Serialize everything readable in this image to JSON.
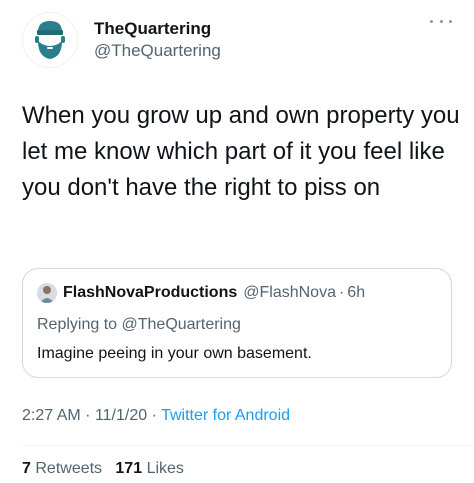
{
  "author": {
    "display_name": "TheQuartering",
    "handle": "@TheQuartering",
    "avatar_icon": "bearded-man-beanie-icon"
  },
  "more_icon": "more-options-icon",
  "tweet": {
    "text": "When you grow up and own property you let me know which part of it you feel like you don't have the right to piss on"
  },
  "quoted_tweet": {
    "display_name": "FlashNovaProductions",
    "handle": "@FlashNova",
    "separator": "·",
    "time": "6h",
    "replying_prefix": "Replying to",
    "replying_to": "@TheQuartering",
    "text": "Imagine peeing in your own basement."
  },
  "meta": {
    "time": "2:27 AM",
    "separator": "·",
    "date": "11/1/20",
    "source": "Twitter for Android"
  },
  "stats": {
    "retweets_count": "7",
    "retweets_label": "Retweets",
    "likes_count": "171",
    "likes_label": "Likes"
  },
  "colors": {
    "text_primary": "#0f1419",
    "text_secondary": "#536471",
    "link": "#1d9bf0",
    "border": "#cfd9de",
    "avatar_teal": "#2a7f8c"
  }
}
